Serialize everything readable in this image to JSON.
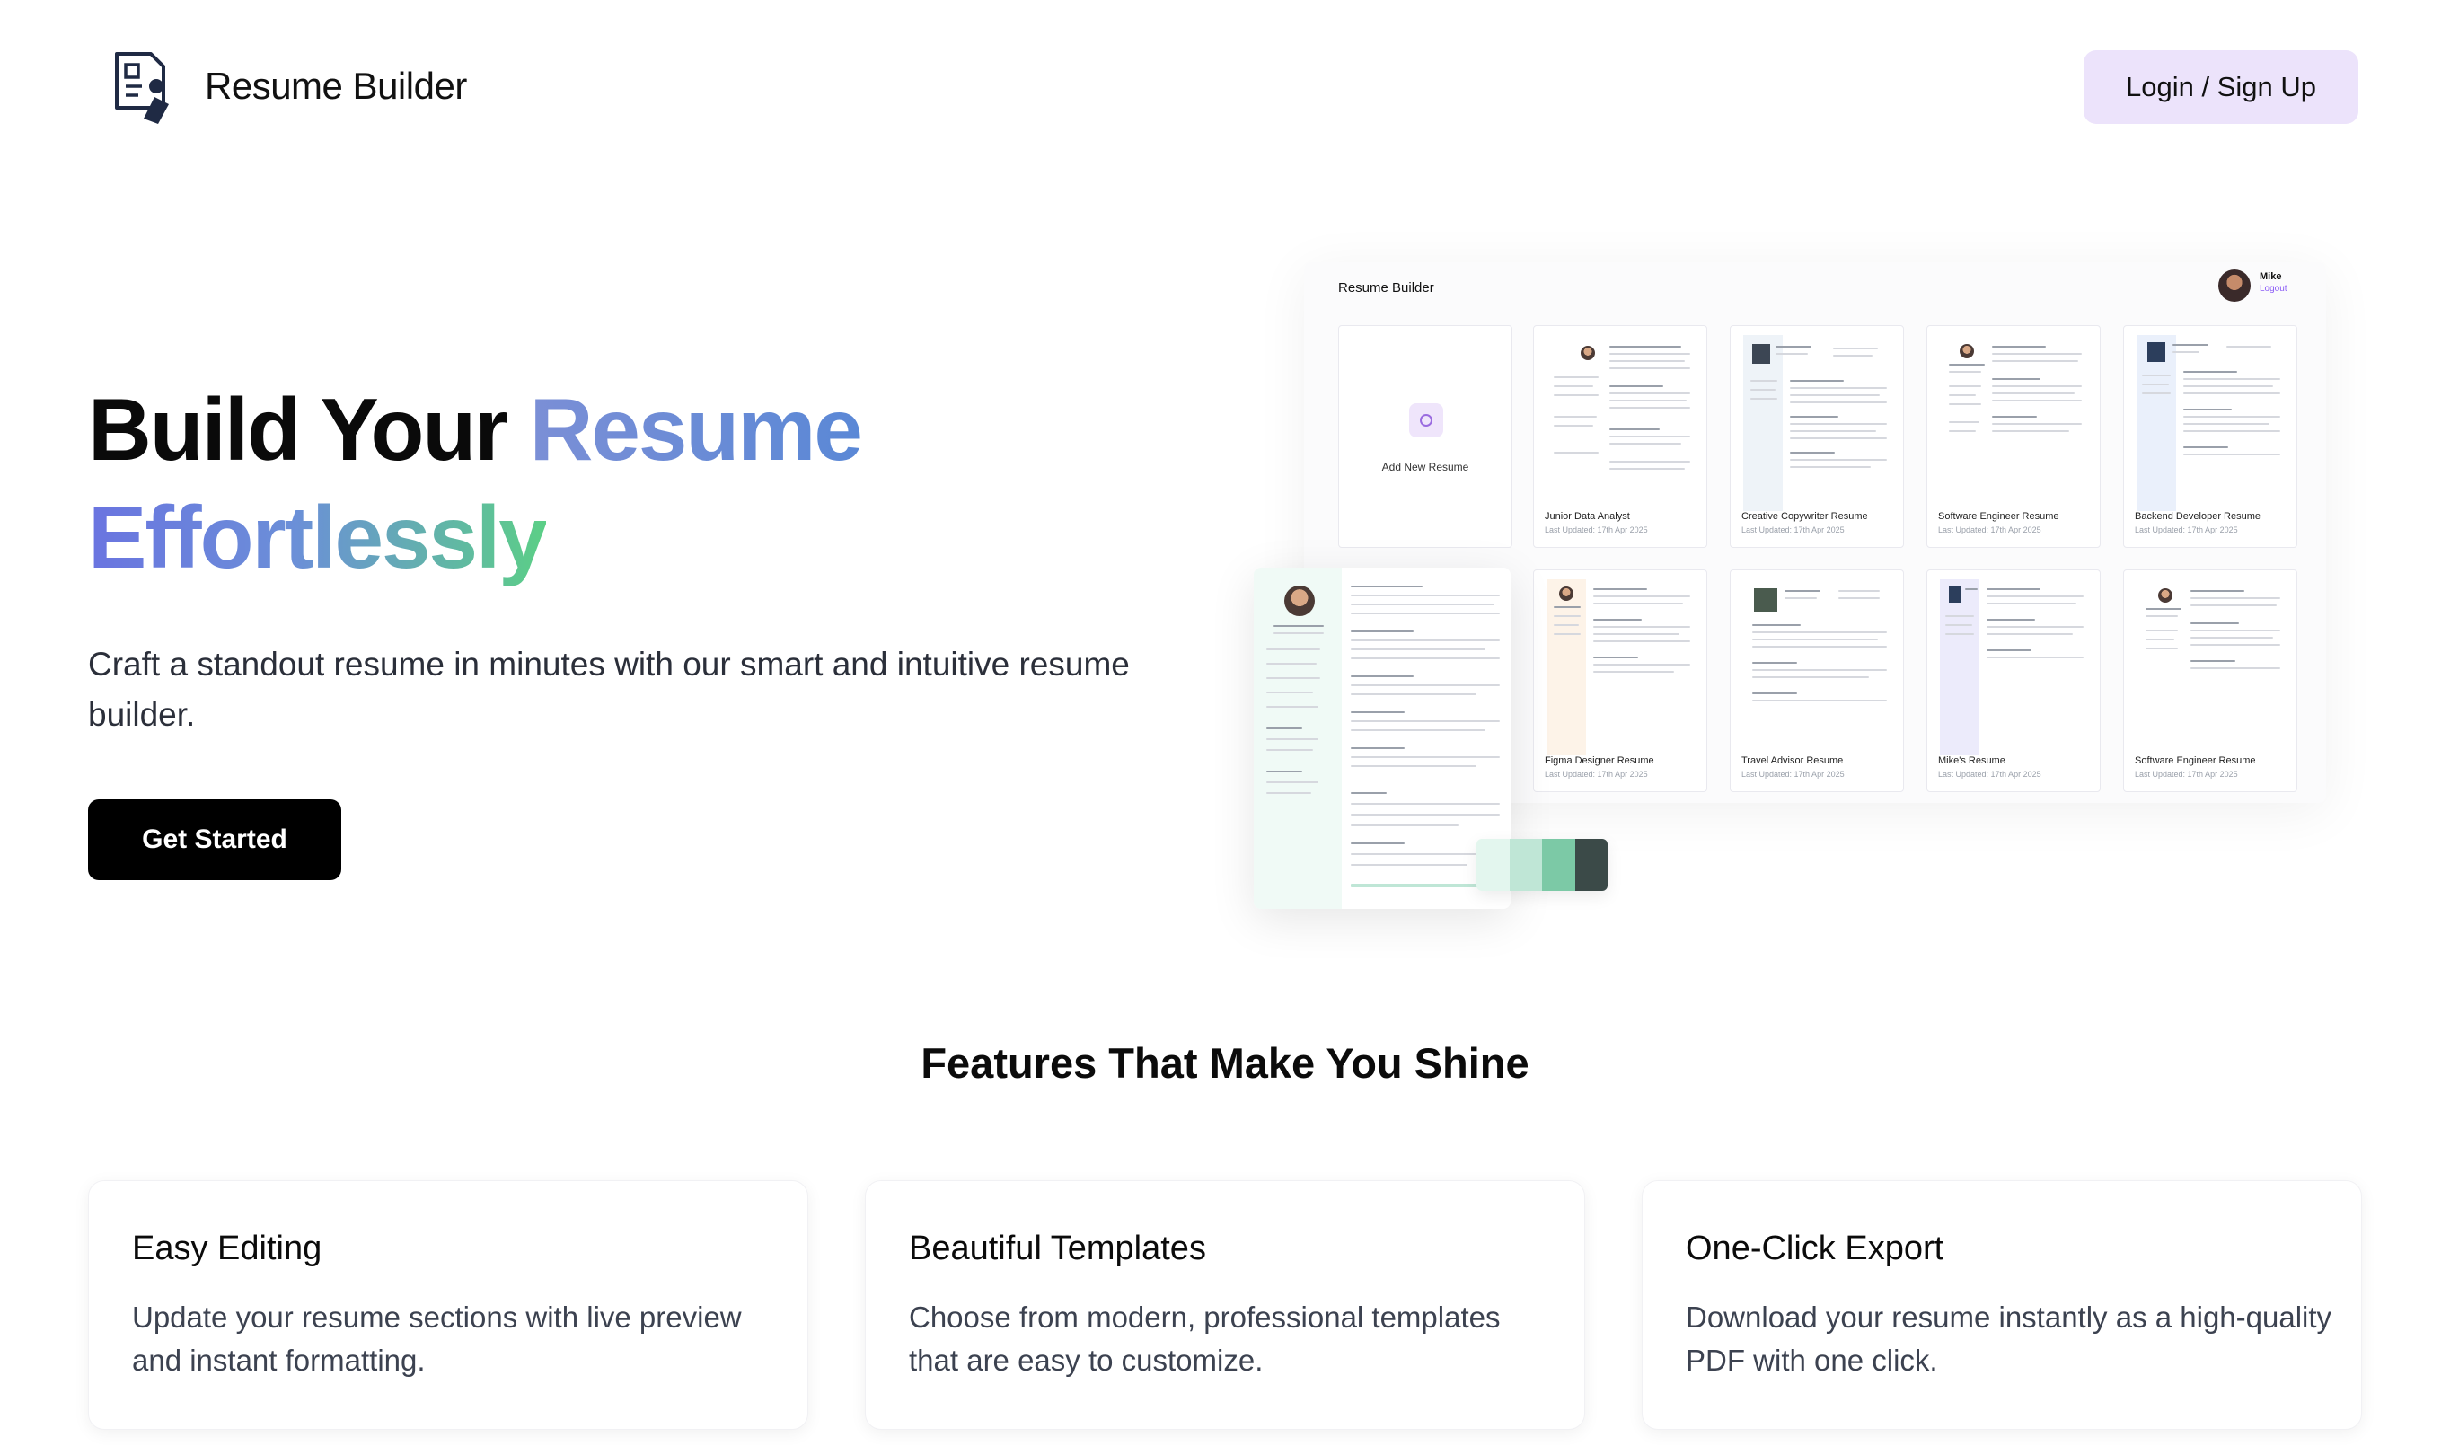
{
  "header": {
    "brand": "Resume Builder",
    "login_label": "Login / Sign Up"
  },
  "hero": {
    "title_line1_plain": "Build Your ",
    "title_line1_accent": "Resume",
    "title_line2_accent": "Effortlessly",
    "subtitle": "Craft a standout resume in minutes with our smart and intuitive resume builder.",
    "cta_label": "Get Started"
  },
  "preview": {
    "brand": "Resume Builder",
    "user_name": "Mike",
    "logout_label": "Logout",
    "add_new_label": "Add New Resume",
    "resumes": [
      {
        "title": "Junior Data Analyst",
        "updated": "Last Updated: 17th Apr 2025"
      },
      {
        "title": "Creative Copywriter Resume",
        "updated": "Last Updated: 17th Apr 2025"
      },
      {
        "title": "Software Engineer Resume",
        "updated": "Last Updated: 17th Apr 2025"
      },
      {
        "title": "Backend Developer Resume",
        "updated": "Last Updated: 17th Apr 2025"
      },
      {
        "title": "Figma Designer Resume",
        "updated": "Last Updated: 17th Apr 2025"
      },
      {
        "title": "Travel Advisor Resume",
        "updated": "Last Updated: 17th Apr 2025"
      },
      {
        "title": "Mike's Resume",
        "updated": "Last Updated: 17th Apr 2025"
      },
      {
        "title": "Software Engineer Resume",
        "updated": "Last Updated: 17th Apr 2025"
      }
    ],
    "swatch_colors": [
      "#e3f6ee",
      "#bfe6d6",
      "#7cc9a6",
      "#3b4a48"
    ]
  },
  "features": {
    "title": "Features That Make You Shine",
    "items": [
      {
        "title": "Easy Editing",
        "description": "Update your resume sections with live preview and instant formatting."
      },
      {
        "title": "Beautiful Templates",
        "description": "Choose from modern, professional templates that are easy to customize."
      },
      {
        "title": "One-Click Export",
        "description": "Download your resume instantly as a high-quality PDF with one click."
      }
    ]
  },
  "colors": {
    "login_bg": "#ece3fb",
    "cta_bg": "#000000",
    "accent_purple": "#8b5cf6"
  }
}
